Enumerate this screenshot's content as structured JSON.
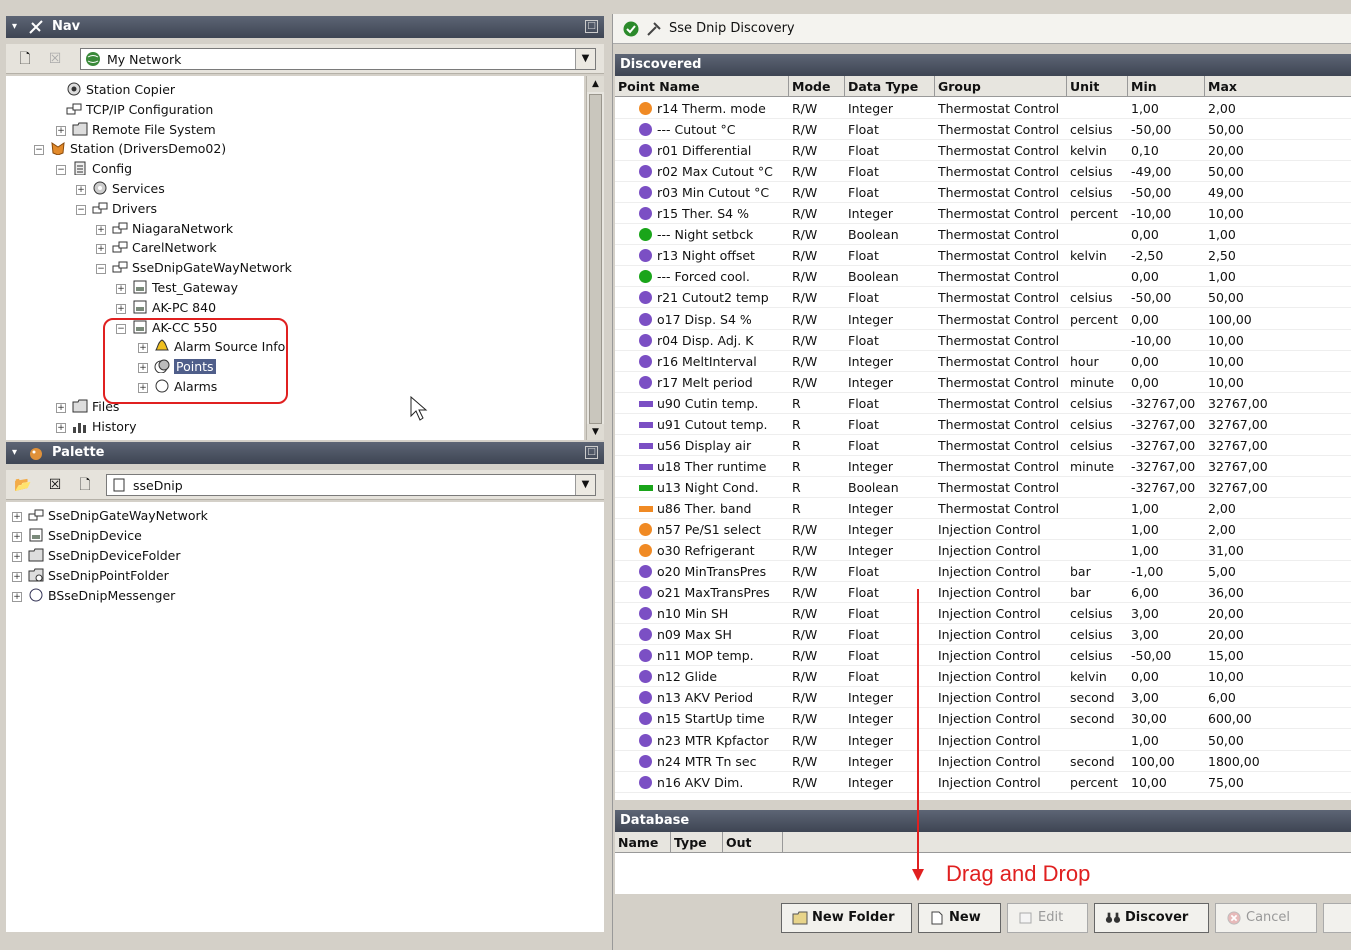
{
  "nav": {
    "title": "Nav",
    "combo_value": "My Network",
    "tree": [
      {
        "label": "Station Copier",
        "icon": "station-copier-icon",
        "expander": ""
      },
      {
        "label": "TCP/IP Configuration",
        "icon": "network-icon",
        "expander": ""
      },
      {
        "label": "Remote File System",
        "icon": "folder-icon",
        "expander": "+"
      },
      {
        "label": "Station (DriversDemo02)",
        "icon": "station-icon",
        "expander": "−"
      },
      {
        "label": "Config",
        "icon": "config-icon",
        "expander": "−"
      },
      {
        "label": "Services",
        "icon": "services-icon",
        "expander": "+"
      },
      {
        "label": "Drivers",
        "icon": "drivers-icon",
        "expander": "−"
      },
      {
        "label": "NiagaraNetwork",
        "icon": "network-icon",
        "expander": "+"
      },
      {
        "label": "CarelNetwork",
        "icon": "network-icon",
        "expander": "+"
      },
      {
        "label": "SseDnipGateWayNetwork",
        "icon": "network-icon",
        "expander": "−"
      },
      {
        "label": "Test_Gateway",
        "icon": "device-icon",
        "expander": "+"
      },
      {
        "label": "AK-PC 840",
        "icon": "device-icon",
        "expander": "+"
      },
      {
        "label": "AK-CC 550",
        "icon": "device-icon",
        "expander": "−"
      },
      {
        "label": "Alarm Source Info",
        "icon": "alarm-bell-icon",
        "expander": "+"
      },
      {
        "label": "Points",
        "icon": "points-icon",
        "expander": "+"
      },
      {
        "label": "Alarms",
        "icon": "alarms-icon",
        "expander": "+"
      },
      {
        "label": "Files",
        "icon": "folder-icon",
        "expander": "+"
      },
      {
        "label": "History",
        "icon": "history-icon",
        "expander": "+"
      }
    ]
  },
  "palette": {
    "title": "Palette",
    "combo_value": "sseDnip",
    "items": [
      {
        "label": "SseDnipGateWayNetwork",
        "icon": "network-icon"
      },
      {
        "label": "SseDnipDevice",
        "icon": "device-icon"
      },
      {
        "label": "SseDnipDeviceFolder",
        "icon": "folder-icon"
      },
      {
        "label": "SseDnipPointFolder",
        "icon": "point-folder-icon"
      },
      {
        "label": "BSseDnipMessenger",
        "icon": "messenger-icon"
      }
    ]
  },
  "discovery": {
    "title": "Sse Dnip Discovery",
    "discovered_label": "Discovered",
    "columns": [
      "Point Name",
      "Mode",
      "Data Type",
      "Group",
      "Unit",
      "Min",
      "Max"
    ],
    "rows": [
      {
        "icon": "orange-circle",
        "name": "r14 Therm. mode",
        "mode": "R/W",
        "type": "Integer",
        "group": "Thermostat Control",
        "unit": "",
        "min": "1,00",
        "max": "2,00"
      },
      {
        "icon": "purple-circle",
        "name": "--- Cutout °C",
        "mode": "R/W",
        "type": "Float",
        "group": "Thermostat Control",
        "unit": "celsius",
        "min": "-50,00",
        "max": "50,00"
      },
      {
        "icon": "purple-circle",
        "name": "r01 Differential",
        "mode": "R/W",
        "type": "Float",
        "group": "Thermostat Control",
        "unit": "kelvin",
        "min": "0,10",
        "max": "20,00"
      },
      {
        "icon": "purple-circle",
        "name": "r02 Max Cutout °C",
        "mode": "R/W",
        "type": "Float",
        "group": "Thermostat Control",
        "unit": "celsius",
        "min": "-49,00",
        "max": "50,00"
      },
      {
        "icon": "purple-circle",
        "name": "r03 Min Cutout °C",
        "mode": "R/W",
        "type": "Float",
        "group": "Thermostat Control",
        "unit": "celsius",
        "min": "-50,00",
        "max": "49,00"
      },
      {
        "icon": "purple-circle",
        "name": "r15 Ther. S4 %",
        "mode": "R/W",
        "type": "Integer",
        "group": "Thermostat Control",
        "unit": "percent",
        "min": "-10,00",
        "max": "10,00"
      },
      {
        "icon": "green-circle",
        "name": "--- Night setbck",
        "mode": "R/W",
        "type": "Boolean",
        "group": "Thermostat Control",
        "unit": "",
        "min": "0,00",
        "max": "1,00"
      },
      {
        "icon": "purple-circle",
        "name": "r13 Night offset",
        "mode": "R/W",
        "type": "Float",
        "group": "Thermostat Control",
        "unit": "kelvin",
        "min": "-2,50",
        "max": "2,50"
      },
      {
        "icon": "green-circle",
        "name": "--- Forced cool.",
        "mode": "R/W",
        "type": "Boolean",
        "group": "Thermostat Control",
        "unit": "",
        "min": "0,00",
        "max": "1,00"
      },
      {
        "icon": "purple-circle",
        "name": "r21 Cutout2 temp",
        "mode": "R/W",
        "type": "Float",
        "group": "Thermostat Control",
        "unit": "celsius",
        "min": "-50,00",
        "max": "50,00"
      },
      {
        "icon": "purple-circle",
        "name": "o17 Disp. S4 %",
        "mode": "R/W",
        "type": "Integer",
        "group": "Thermostat Control",
        "unit": "percent",
        "min": "0,00",
        "max": "100,00"
      },
      {
        "icon": "purple-circle",
        "name": "r04 Disp. Adj. K",
        "mode": "R/W",
        "type": "Float",
        "group": "Thermostat Control",
        "unit": "",
        "min": "-10,00",
        "max": "10,00"
      },
      {
        "icon": "purple-circle",
        "name": "r16 MeltInterval",
        "mode": "R/W",
        "type": "Integer",
        "group": "Thermostat Control",
        "unit": "hour",
        "min": "0,00",
        "max": "10,00"
      },
      {
        "icon": "purple-circle",
        "name": "r17 Melt period",
        "mode": "R/W",
        "type": "Integer",
        "group": "Thermostat Control",
        "unit": "minute",
        "min": "0,00",
        "max": "10,00"
      },
      {
        "icon": "purple-bar",
        "name": "u90 Cutin temp.",
        "mode": "R",
        "type": "Float",
        "group": "Thermostat Control",
        "unit": "celsius",
        "min": "-32767,00",
        "max": "32767,00"
      },
      {
        "icon": "purple-bar",
        "name": "u91 Cutout temp.",
        "mode": "R",
        "type": "Float",
        "group": "Thermostat Control",
        "unit": "celsius",
        "min": "-32767,00",
        "max": "32767,00"
      },
      {
        "icon": "purple-bar",
        "name": "u56 Display air",
        "mode": "R",
        "type": "Float",
        "group": "Thermostat Control",
        "unit": "celsius",
        "min": "-32767,00",
        "max": "32767,00"
      },
      {
        "icon": "purple-bar",
        "name": "u18 Ther runtime",
        "mode": "R",
        "type": "Integer",
        "group": "Thermostat Control",
        "unit": "minute",
        "min": "-32767,00",
        "max": "32767,00"
      },
      {
        "icon": "green-bar",
        "name": "u13 Night Cond.",
        "mode": "R",
        "type": "Boolean",
        "group": "Thermostat Control",
        "unit": "",
        "min": "-32767,00",
        "max": "32767,00"
      },
      {
        "icon": "orange-bar",
        "name": "u86 Ther. band",
        "mode": "R",
        "type": "Integer",
        "group": "Thermostat Control",
        "unit": "",
        "min": "1,00",
        "max": "2,00"
      },
      {
        "icon": "orange-circle",
        "name": "n57 Pe/S1 select",
        "mode": "R/W",
        "type": "Integer",
        "group": "Injection Control",
        "unit": "",
        "min": "1,00",
        "max": "2,00"
      },
      {
        "icon": "orange-circle",
        "name": "o30 Refrigerant",
        "mode": "R/W",
        "type": "Integer",
        "group": "Injection Control",
        "unit": "",
        "min": "1,00",
        "max": "31,00"
      },
      {
        "icon": "purple-circle",
        "name": "o20 MinTransPres",
        "mode": "R/W",
        "type": "Float",
        "group": "Injection Control",
        "unit": "bar",
        "min": "-1,00",
        "max": "5,00"
      },
      {
        "icon": "purple-circle",
        "name": "o21 MaxTransPres",
        "mode": "R/W",
        "type": "Float",
        "group": "Injection Control",
        "unit": "bar",
        "min": "6,00",
        "max": "36,00"
      },
      {
        "icon": "purple-circle",
        "name": "n10 Min SH",
        "mode": "R/W",
        "type": "Float",
        "group": "Injection Control",
        "unit": "celsius",
        "min": "3,00",
        "max": "20,00"
      },
      {
        "icon": "purple-circle",
        "name": "n09 Max SH",
        "mode": "R/W",
        "type": "Float",
        "group": "Injection Control",
        "unit": "celsius",
        "min": "3,00",
        "max": "20,00"
      },
      {
        "icon": "purple-circle",
        "name": "n11 MOP temp.",
        "mode": "R/W",
        "type": "Float",
        "group": "Injection Control",
        "unit": "celsius",
        "min": "-50,00",
        "max": "15,00"
      },
      {
        "icon": "purple-circle",
        "name": "n12 Glide",
        "mode": "R/W",
        "type": "Float",
        "group": "Injection Control",
        "unit": "kelvin",
        "min": "0,00",
        "max": "10,00"
      },
      {
        "icon": "purple-circle",
        "name": "n13 AKV Period",
        "mode": "R/W",
        "type": "Integer",
        "group": "Injection Control",
        "unit": "second",
        "min": "3,00",
        "max": "6,00"
      },
      {
        "icon": "purple-circle",
        "name": "n15 StartUp time",
        "mode": "R/W",
        "type": "Integer",
        "group": "Injection Control",
        "unit": "second",
        "min": "30,00",
        "max": "600,00"
      },
      {
        "icon": "purple-circle",
        "name": "n23 MTR Kpfactor",
        "mode": "R/W",
        "type": "Integer",
        "group": "Injection Control",
        "unit": "",
        "min": "1,00",
        "max": "50,00"
      },
      {
        "icon": "purple-circle",
        "name": "n24 MTR Tn sec",
        "mode": "R/W",
        "type": "Integer",
        "group": "Injection Control",
        "unit": "second",
        "min": "100,00",
        "max": "1800,00"
      },
      {
        "icon": "purple-circle",
        "name": "n16 AKV Dim.",
        "mode": "R/W",
        "type": "Integer",
        "group": "Injection Control",
        "unit": "percent",
        "min": "10,00",
        "max": "75,00"
      }
    ],
    "database_label": "Database",
    "db_columns": [
      "Name",
      "Type",
      "Out"
    ]
  },
  "annotation": {
    "text": "Drag and Drop",
    "color": "#e02020"
  },
  "buttons": {
    "new_folder": "New Folder",
    "new": "New",
    "edit": "Edit",
    "discover": "Discover",
    "cancel": "Cancel"
  },
  "colors": {
    "header_dark": "#4a5160",
    "purple": "#7b4fc4",
    "orange": "#f08a24",
    "green": "#1aa51a",
    "selection": "#4f5e8a"
  }
}
